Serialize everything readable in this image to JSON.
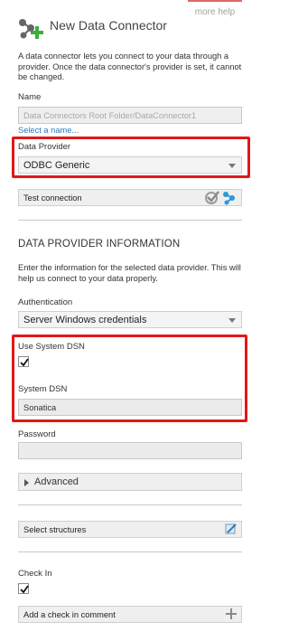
{
  "header": {
    "more_help": "more help",
    "title": "New Data Connector",
    "icon": "data-connector-add-icon"
  },
  "description": "A data connector lets you connect to your data through a provider. Once the data connector's provider is set, it cannot be changed.",
  "name_section": {
    "label": "Name",
    "value": "Data Connectors Root Folder/DataConnector1",
    "select_link": "Select a name..."
  },
  "provider": {
    "label": "Data Provider",
    "selected": "ODBC Generic"
  },
  "test_connection": {
    "label": "Test connection",
    "icons": [
      "check-circle-icon",
      "share-network-icon"
    ]
  },
  "provider_info": {
    "title": "DATA PROVIDER INFORMATION",
    "description": "Enter the information for the selected data provider. This will help us connect to your data properly."
  },
  "authentication": {
    "label": "Authentication",
    "selected": "Server Windows credentials"
  },
  "system_dsn_toggle": {
    "label": "Use System DSN",
    "checked": true
  },
  "system_dsn": {
    "label": "System DSN",
    "value": "Sonatica"
  },
  "password": {
    "label": "Password",
    "value": ""
  },
  "advanced": {
    "label": "Advanced"
  },
  "select_structures": {
    "label": "Select structures",
    "icon": "edit-structures-icon"
  },
  "check_in": {
    "label": "Check In",
    "checked": true,
    "comment_label": "Add a check in comment",
    "add_icon": "plus-icon"
  },
  "colors": {
    "highlight": "#e01818",
    "accent_blue": "#2a9ad8",
    "brand_green": "#3cae3c"
  }
}
